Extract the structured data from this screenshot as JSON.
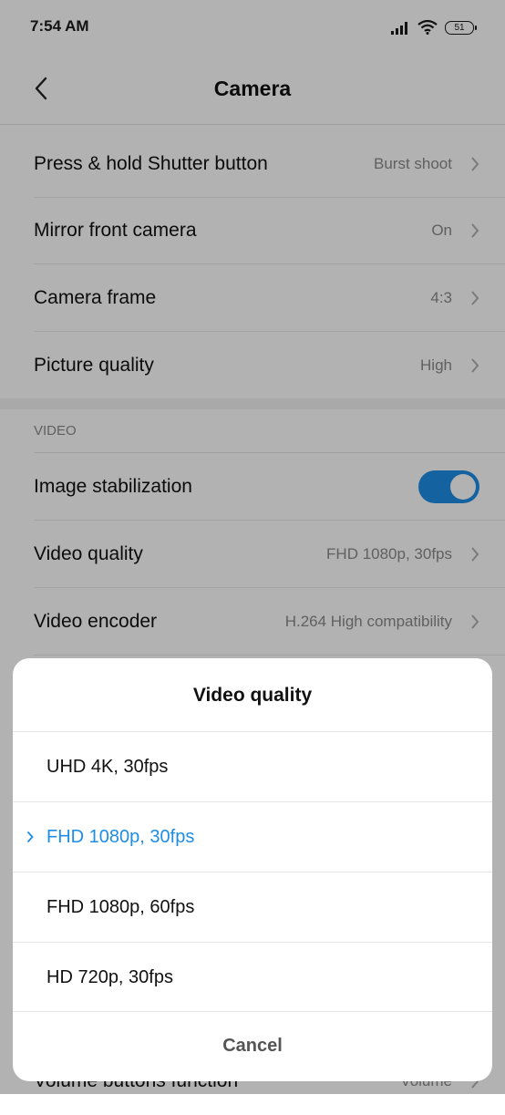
{
  "status_bar": {
    "time": "7:54 AM",
    "battery": "51"
  },
  "header": {
    "title": "Camera"
  },
  "settings": {
    "rows_top": [
      {
        "label": "Press & hold Shutter button",
        "value": "Burst shoot"
      },
      {
        "label": "Mirror front camera",
        "value": "On"
      },
      {
        "label": "Camera frame",
        "value": "4:3"
      },
      {
        "label": "Picture quality",
        "value": "High"
      }
    ],
    "video_section": "VIDEO",
    "image_stabilization": {
      "label": "Image stabilization",
      "enabled": true
    },
    "rows_video": [
      {
        "label": "Video quality",
        "value": "FHD 1080p, 30fps"
      },
      {
        "label": "Video encoder",
        "value": "H.264 High compatibility"
      }
    ],
    "bottom_row": {
      "label": "Volume buttons function",
      "value": "Volume"
    }
  },
  "dialog": {
    "title": "Video quality",
    "options": [
      {
        "label": "UHD 4K, 30fps",
        "selected": false
      },
      {
        "label": "FHD 1080p, 30fps",
        "selected": true
      },
      {
        "label": "FHD 1080p, 60fps",
        "selected": false
      },
      {
        "label": "HD 720p, 30fps",
        "selected": false
      }
    ],
    "cancel": "Cancel"
  },
  "colors": {
    "accent": "#1e8de6",
    "scrim": "rgba(0,0,0,0.30)"
  },
  "icons": [
    "signal-icon",
    "wifi-icon",
    "battery-icon",
    "back-arrow-icon",
    "chevron-right-icon",
    "check-chevron-icon"
  ]
}
